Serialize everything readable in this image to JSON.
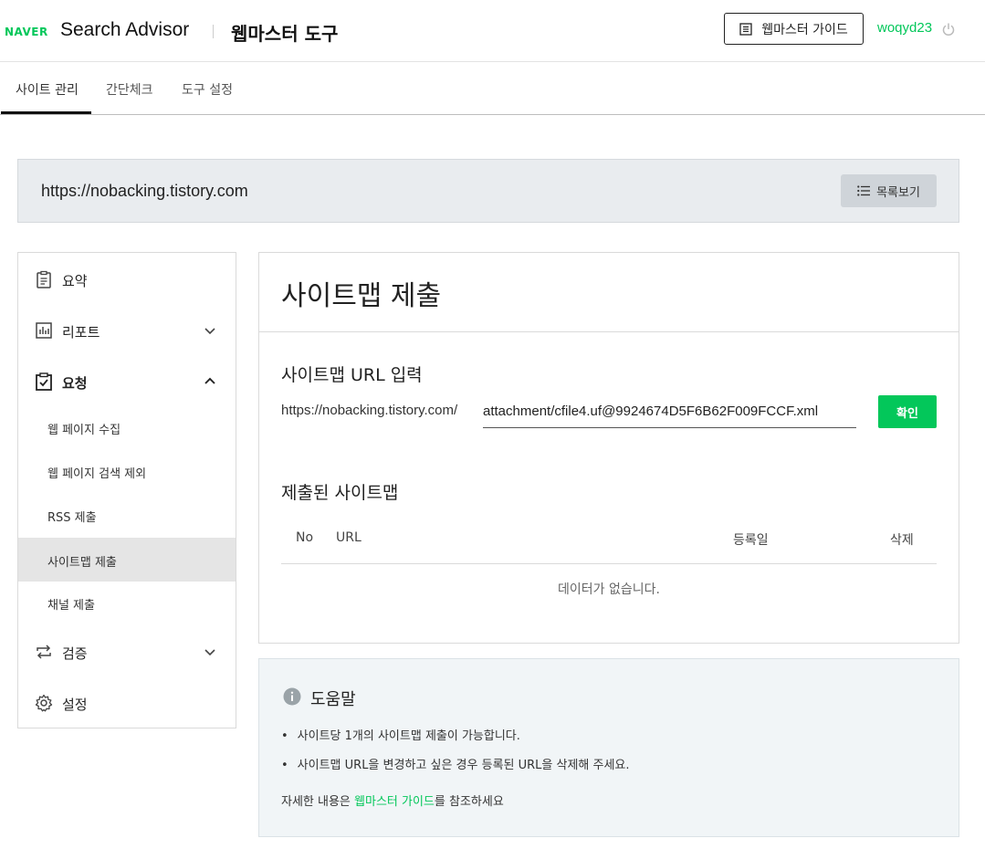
{
  "header": {
    "logo": "NAVER",
    "brand": "Search Advisor",
    "tool_title": "웹마스터 도구",
    "guide_button": "웹마스터 가이드",
    "username": "woqyd23"
  },
  "tabs": [
    {
      "label": "사이트 관리",
      "active": true
    },
    {
      "label": "간단체크",
      "active": false
    },
    {
      "label": "도구 설정",
      "active": false
    }
  ],
  "site": {
    "url": "https://nobacking.tistory.com",
    "list_button": "목록보기"
  },
  "sidebar": {
    "items": [
      {
        "label": "요약",
        "icon": "clipboard-icon"
      },
      {
        "label": "리포트",
        "icon": "chart-icon"
      },
      {
        "label": "요청",
        "icon": "checkbox-icon",
        "expanded": true
      },
      {
        "label": "검증",
        "icon": "repeat-icon"
      },
      {
        "label": "설정",
        "icon": "gear-icon"
      }
    ],
    "sub_items": [
      {
        "label": "웹 페이지 수집"
      },
      {
        "label": "웹 페이지 검색 제외"
      },
      {
        "label": "RSS 제출"
      },
      {
        "label": "사이트맵 제출",
        "active": true
      },
      {
        "label": "채널 제출"
      }
    ]
  },
  "main": {
    "title": "사이트맵 제출",
    "input_section_title": "사이트맵 URL 입력",
    "url_prefix": "https://nobacking.tistory.com/",
    "url_value": "attachment/cfile4.uf@9924674D5F6B62F009FCCF.xml",
    "confirm_button": "확인",
    "submitted_title": "제출된 사이트맵",
    "table_headers": [
      "No",
      "URL",
      "등록일",
      "삭제"
    ],
    "empty_message": "데이터가 없습니다."
  },
  "help": {
    "title": "도움말",
    "items": [
      "사이트당 1개의 사이트맵 제출이 가능합니다.",
      "사이트맵 URL을 변경하고 싶은 경우 등록된 URL을 삭제해 주세요."
    ],
    "more_prefix": "자세한 내용은 ",
    "more_link": "웹마스터 가이드",
    "more_suffix": "를 참조하세요"
  },
  "colors": {
    "brand_green": "#03c75a",
    "site_bar_bg": "#e9ecef",
    "help_bg": "#f1f5f7"
  }
}
